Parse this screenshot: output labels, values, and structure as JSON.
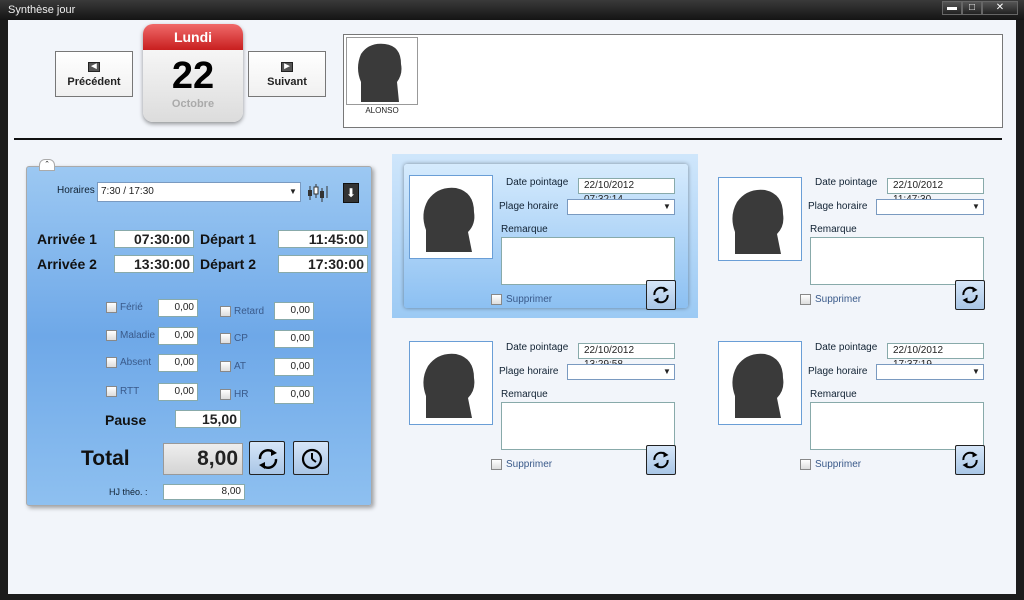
{
  "window": {
    "title": "Synthèse jour",
    "min": "▬",
    "max": "□",
    "close": "✕"
  },
  "nav": {
    "prev_label": "Précédent",
    "next_label": "Suivant"
  },
  "calendar": {
    "weekday": "Lundi",
    "day": "22",
    "month": "Octobre"
  },
  "employee": {
    "name": "ALONSO"
  },
  "summary": {
    "horaires_label": "Horaires",
    "horaires_value": "7:30 / 17:30",
    "arrivee1_label": "Arrivée 1",
    "arrivee1": "07:30:00",
    "depart1_label": "Départ 1",
    "depart1": "11:45:00",
    "arrivee2_label": "Arrivée 2",
    "arrivee2": "13:30:00",
    "depart2_label": "Départ 2",
    "depart2": "17:30:00",
    "absences_left": [
      {
        "label": "Férié",
        "value": "0,00"
      },
      {
        "label": "Maladie",
        "value": "0,00"
      },
      {
        "label": "Absent",
        "value": "0,00"
      },
      {
        "label": "RTT",
        "value": "0,00"
      }
    ],
    "absences_right": [
      {
        "label": "Retard",
        "value": "0,00"
      },
      {
        "label": "CP",
        "value": "0,00"
      },
      {
        "label": "AT",
        "value": "0,00"
      },
      {
        "label": "HR",
        "value": "0,00"
      }
    ],
    "pause_label": "Pause",
    "pause_value": "15,00",
    "total_label": "Total",
    "total_value": "8,00",
    "hj_label": "HJ théo. :",
    "hj_value": "8,00"
  },
  "cards_labels": {
    "date": "Date pointage",
    "plage": "Plage horaire",
    "remarque": "Remarque",
    "supprimer": "Supprimer"
  },
  "cards": [
    {
      "date": "22/10/2012 07:32:14",
      "selected": true
    },
    {
      "date": "22/10/2012 11:47:30",
      "selected": false
    },
    {
      "date": "22/10/2012 13:29:58",
      "selected": false
    },
    {
      "date": "22/10/2012 17:37:19",
      "selected": false
    }
  ],
  "colors": {
    "calendar_header": "#d93434",
    "panel_blue": "#6ea8e8",
    "selected_card": "#9ccaf4"
  },
  "icons": {
    "refresh": "refresh-icon",
    "clock": "clock-icon",
    "chart": "candlestick-chart-icon",
    "download": "arrow-down-icon"
  }
}
